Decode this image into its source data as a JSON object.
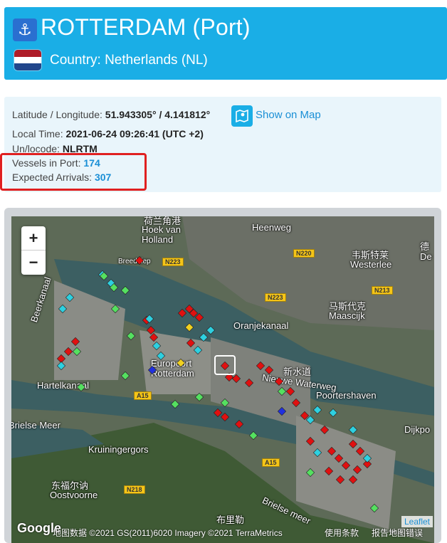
{
  "header": {
    "title": "ROTTERDAM (Port)",
    "country_label": "Country: Netherlands (NL)",
    "anchor_icon": "anchor-icon",
    "flag_colors": [
      "#ae1c28",
      "#ffffff",
      "#21468b"
    ]
  },
  "info": {
    "latlon_label": "Latitude / Longitude:",
    "latlon_value": "51.943305° / 4.141812°",
    "show_on_map": "Show on Map",
    "local_time_label": "Local Time:",
    "local_time_value": "2021-06-24 09:26:41 (UTC +2)",
    "unlocode_label": "Un/locode:",
    "unlocode_value": "NLRTM",
    "vessels_label": "Vessels in Port:",
    "vessels_value": "174",
    "arrivals_label": "Expected Arrivals:",
    "arrivals_value": "307"
  },
  "map": {
    "zoom_in": "+",
    "zoom_out": "−",
    "labels": {
      "hoek_cn": "荷兰角港",
      "hoek": "Hoek van Holland",
      "heenweg": "Heenweg",
      "breeddiep": "Breeddiep",
      "westerlee_cn": "韦斯特莱",
      "westerlee": "Westerlee",
      "de": "德 De",
      "maassijk_cn": "马斯代克",
      "maassijk": "Maascijk",
      "oranjekanaal": "Oranjekanaal",
      "beerkanaal": "Beerkanaal",
      "europoort": "Europoort Rotterdam",
      "nieuwe_cn": "新水道",
      "nieuwe": "Nieuwe Waterweg",
      "poortershaven": "Poortershaven",
      "hartelkanaal": "Hartelkanaal",
      "brielse": "Brielse Meer",
      "brielse2": "Brielse meer",
      "kruiningergors": "Kruiningergors",
      "oostvoorne_cn": "东福尔讷",
      "oostvoorne": "Oostvoorne",
      "dijkpoort": "Dijkpo",
      "brielle_cn": "布里勒"
    },
    "roads": [
      "N223",
      "N220",
      "N223",
      "N213",
      "A15",
      "A15",
      "N218"
    ],
    "leaflet": "Leaflet",
    "google": "Google",
    "attribution": "地图数据 ©2021 GS(2011)6020 Imagery ©2021 TerraMetrics",
    "terms": "使用条款",
    "report": "报告地图错误"
  }
}
